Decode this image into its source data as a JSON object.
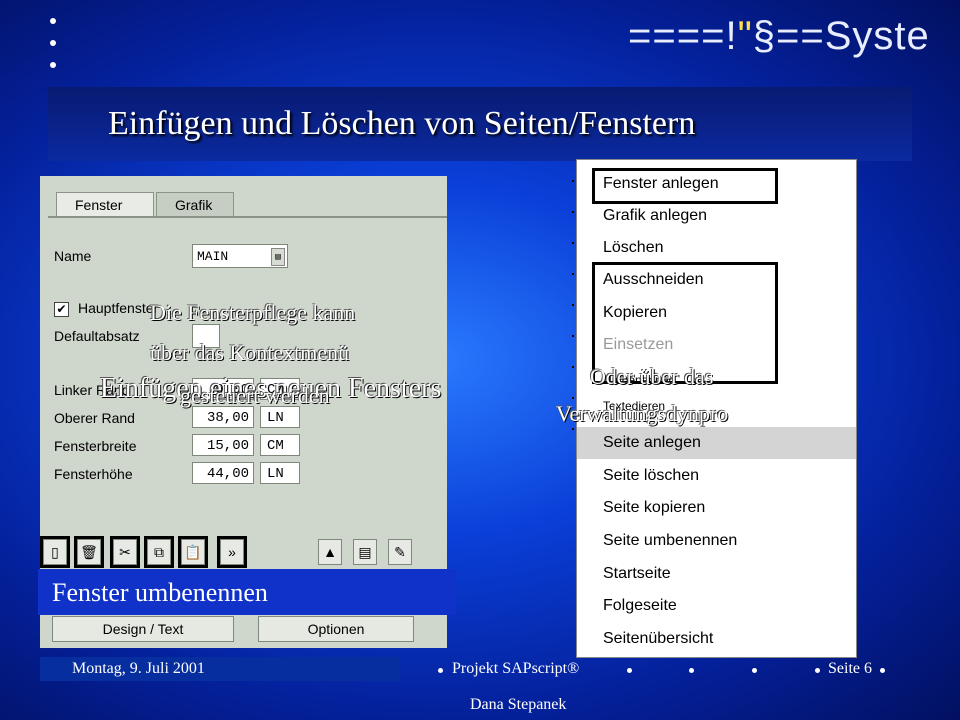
{
  "header": {
    "brand_prefix": "====!",
    "brand_quote": "\"",
    "brand_suffix": "§==Syste",
    "slide_title": "Einfügen und Löschen von Seiten/Fenstern"
  },
  "sap_panel": {
    "tabs": [
      "Fenster",
      "Grafik"
    ],
    "name_label": "Name",
    "name_value": "MAIN",
    "hauptfenster_label": "Hauptfenster",
    "hauptfenster_checked": true,
    "defaultabsatz_label": "Defaultabsatz",
    "fields": [
      {
        "label": "Linker Rand",
        "value": "0,00",
        "unit": "CM"
      },
      {
        "label": "Oberer Rand",
        "value": "38,00",
        "unit": "LN"
      },
      {
        "label": "Fensterbreite",
        "value": "15,00",
        "unit": "CM"
      },
      {
        "label": "Fensterhöhe",
        "value": "44,00",
        "unit": "LN"
      }
    ],
    "toolbar_icons": [
      "create-icon",
      "delete-icon",
      "cut-icon",
      "copy-icon",
      "paste-icon",
      "rename-icon",
      "graphic-icon",
      "form-icon",
      "edit-icon"
    ],
    "bottom_buttons": [
      "Design / Text",
      "Optionen"
    ]
  },
  "captions": {
    "left_1": "Die Fensterpflege kann",
    "left_2": "über das Kontextmenü",
    "left_3": "Einfügen eines neuen Fensters",
    "left_4": "gesteuert werden",
    "right_1": "Oder über das",
    "right_2": "Verwaltungsdynpro",
    "band": "Fenster umbenennen"
  },
  "context_menu": {
    "items": [
      {
        "label": "Fenster anlegen",
        "disabled": false
      },
      {
        "label": "Grafik anlegen",
        "disabled": false
      },
      {
        "label": "Löschen",
        "disabled": false
      },
      {
        "label": "Ausschneiden",
        "disabled": false
      },
      {
        "label": "Kopieren",
        "disabled": false
      },
      {
        "label": "Einsetzen",
        "disabled": true
      },
      {
        "label": "Umbenennen",
        "disabled": false
      },
      {
        "label": "Textedieren",
        "disabled": false
      },
      {
        "label": "Seite anlegen",
        "disabled": false
      },
      {
        "label": "Seite löschen",
        "disabled": false
      },
      {
        "label": "Seite kopieren",
        "disabled": false
      },
      {
        "label": "Seite umbenennen",
        "disabled": false
      },
      {
        "label": "Startseite",
        "disabled": false
      },
      {
        "label": "Folgeseite",
        "disabled": false
      },
      {
        "label": "Seitenübersicht",
        "disabled": false
      }
    ],
    "selected": "Seite anlegen"
  },
  "footer": {
    "date": "Montag, 9. Juli 2001",
    "project": "Projekt SAPscript®",
    "page": "Seite 6",
    "author": "Dana Stepanek"
  }
}
